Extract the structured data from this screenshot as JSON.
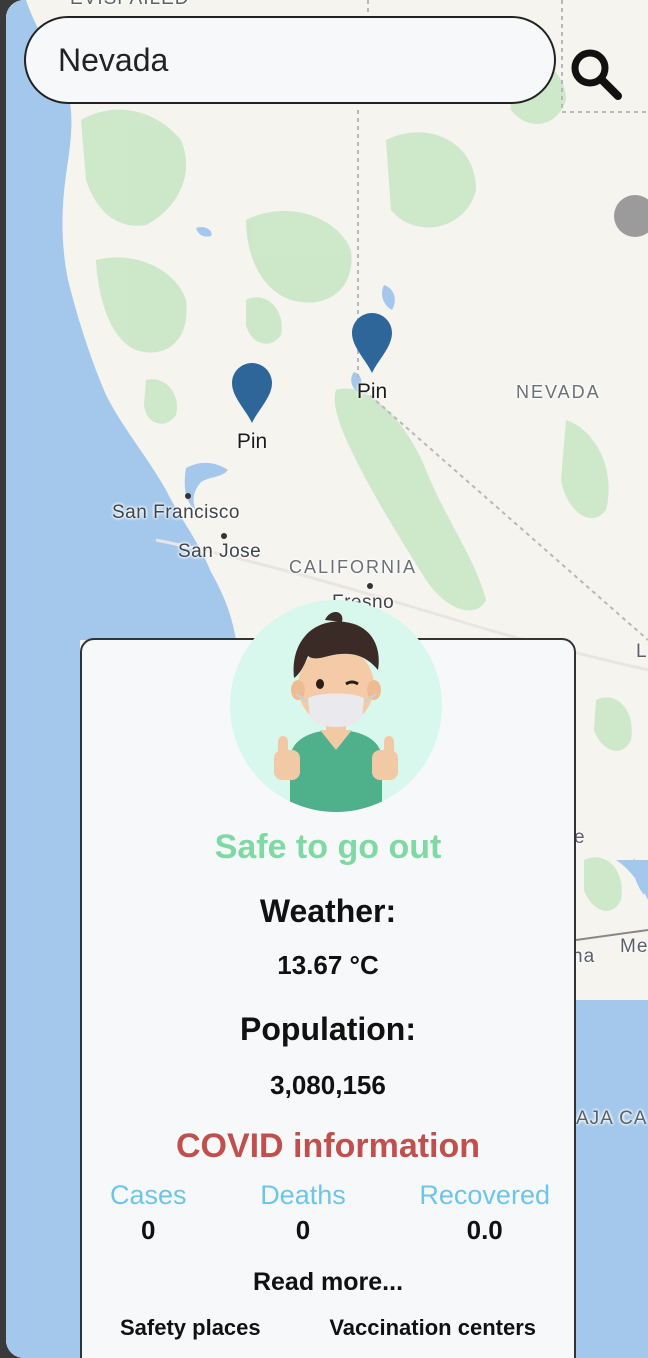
{
  "search": {
    "value": "Nevada"
  },
  "map": {
    "top_partial_label": "EVISPAILED",
    "cities": [
      "San Francisco",
      "San Jose",
      "Fresno"
    ],
    "states": [
      "NEVADA",
      "CALIFORNIA"
    ],
    "edge_labels": [
      "L",
      "e",
      "na",
      "Me",
      "AJA CA"
    ],
    "pins": [
      {
        "label": "Pin"
      },
      {
        "label": "Pin"
      }
    ]
  },
  "card": {
    "status": "Safe to go out",
    "weather_label": "Weather:",
    "weather_value": "13.67 °C",
    "population_label": "Population:",
    "population_value": "3,080,156",
    "covid_title": "COVID information",
    "stats": [
      {
        "label": "Cases",
        "value": "0"
      },
      {
        "label": "Deaths",
        "value": "0"
      },
      {
        "label": "Recovered",
        "value": "0.0"
      }
    ],
    "read_more": "Read more...",
    "links": [
      "Safety places",
      "Vaccination centers"
    ]
  },
  "colors": {
    "safe": "#7fd9a2",
    "covid": "#c0504d",
    "stat_label": "#6cc6e8",
    "pin": "#2f6699",
    "water": "#a3c8ec",
    "forest": "#c8e6c4"
  },
  "icons": {
    "search": "search-icon",
    "avatar": "masked-person-thumbs-up",
    "pin": "map-pin-icon"
  }
}
